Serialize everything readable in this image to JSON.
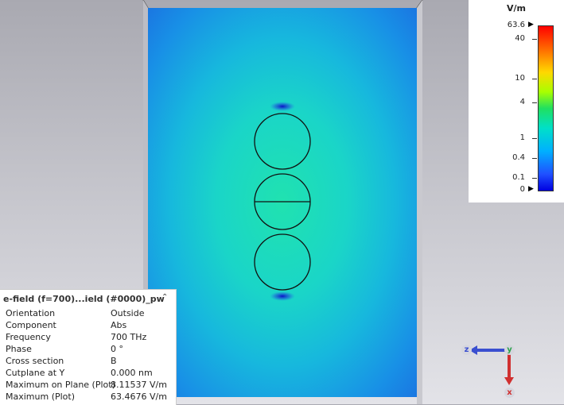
{
  "legend": {
    "unit": "V/m",
    "ticks": [
      "63.6",
      "40",
      "10",
      "4",
      "1",
      "0.4",
      "0.1",
      "0"
    ]
  },
  "info_panel": {
    "title": "e-field (f=700)...ield (#0000)_pw",
    "rows": [
      {
        "key": "Orientation",
        "value": "Outside"
      },
      {
        "key": "Component",
        "value": "Abs"
      },
      {
        "key": "Frequency",
        "value": "700 THz"
      },
      {
        "key": "Phase",
        "value": "0 °"
      },
      {
        "key": "Cross section",
        "value": "B"
      },
      {
        "key": "Cutplane at Y",
        "value": "0.000 nm"
      },
      {
        "key": "Maximum on Plane (Plot)",
        "value": "8.11537 V/m"
      },
      {
        "key": "Maximum (Plot)",
        "value": "63.4676 V/m"
      }
    ]
  },
  "axes": {
    "z_label": "z",
    "y_label": "y",
    "x_label": "x",
    "z_color": "#3a4fd0",
    "y_color": "#2aa14a",
    "x_color": "#d03030"
  },
  "colors": {
    "field_high": "#1be0b0",
    "field_low": "#1a7fe0"
  }
}
